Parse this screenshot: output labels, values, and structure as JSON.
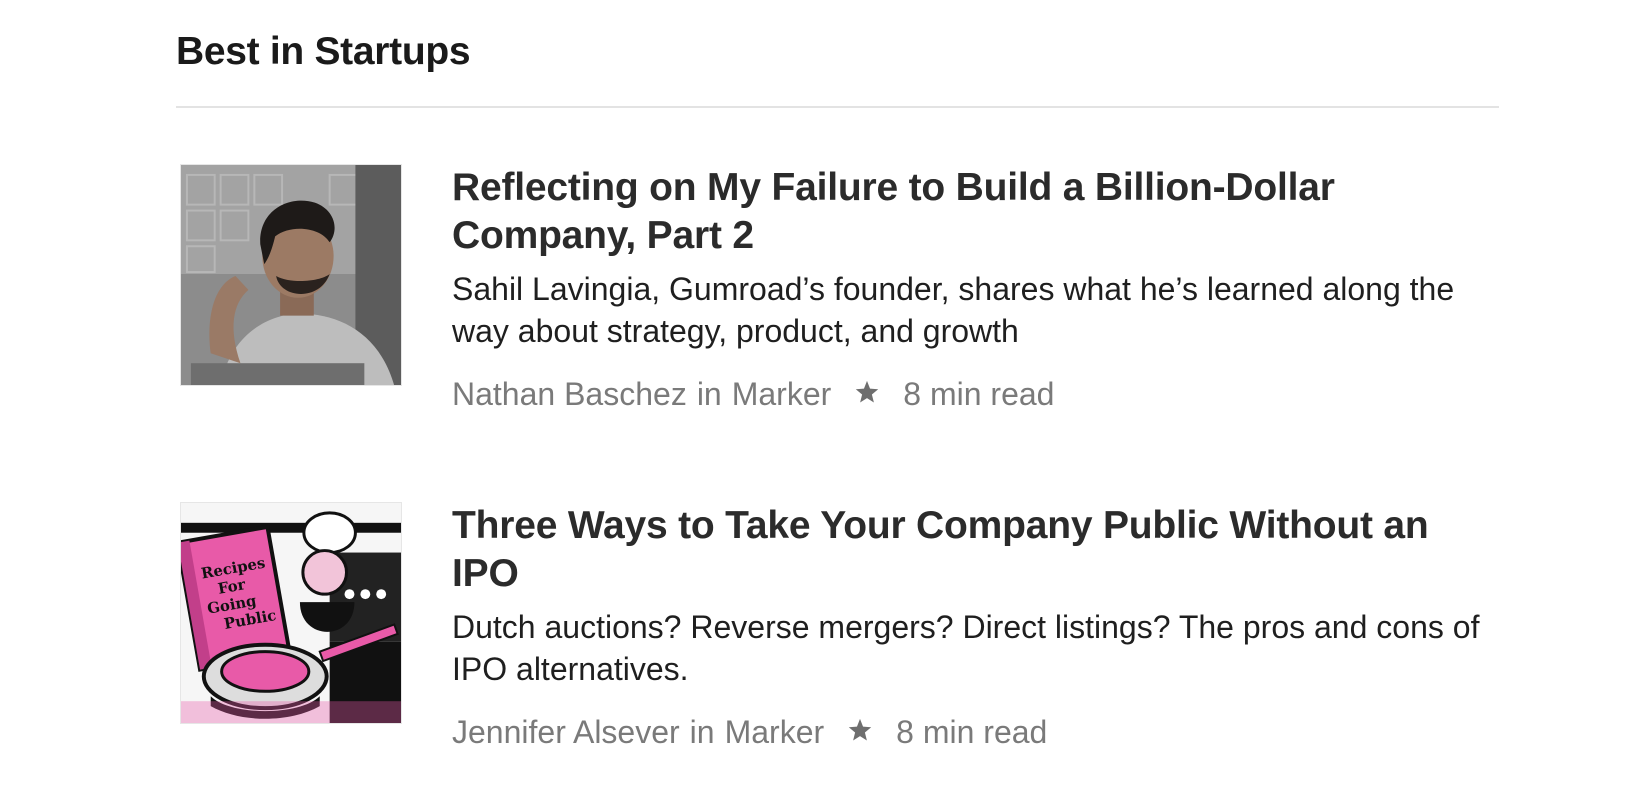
{
  "section": {
    "title": "Best in Startups"
  },
  "articles": [
    {
      "title": "Reflecting on My Failure to Build a Billion-Dollar Company, Part 2",
      "subtitle": "Sahil Lavingia, Gumroad’s founder, shares what he’s learned along the way about strategy, product, and growth",
      "author": "Nathan Baschez",
      "in_word": "in",
      "publication": "Marker",
      "read_time": "8 min read",
      "member_icon": "star-icon"
    },
    {
      "title": "Three Ways to Take Your Company Public Without an IPO",
      "subtitle": "Dutch auctions? Reverse mergers? Direct listings? The pros and cons of IPO alternatives.",
      "author": "Jennifer Alsever",
      "in_word": "in",
      "publication": "Marker",
      "read_time": "8 min read",
      "member_icon": "star-icon",
      "thumbnail_book_text": [
        "Recipes",
        "For",
        "Going",
        "Public"
      ]
    }
  ],
  "colors": {
    "text_primary": "#292929",
    "text_meta": "#7a7a7a",
    "divider": "#e3e3e3",
    "thumb_accent_pink": "#e85aa8"
  }
}
